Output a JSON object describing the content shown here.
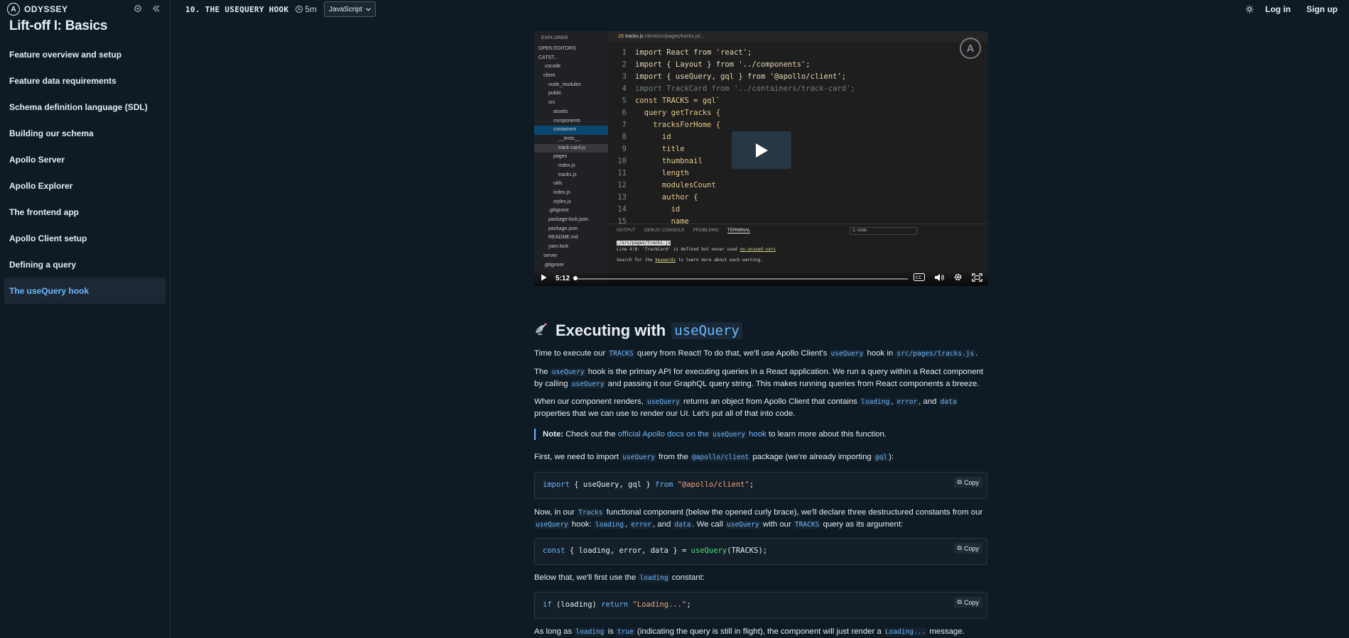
{
  "brand": "ODYSSEY",
  "course_title": "Lift-off I: Basics",
  "nav": [
    "Feature overview and setup",
    "Feature data requirements",
    "Schema definition language (SDL)",
    "Building our schema",
    "Apollo Server",
    "Apollo Explorer",
    "The frontend app",
    "Apollo Client setup",
    "Defining a query",
    "The useQuery hook"
  ],
  "topbar": {
    "lesson_title": "10. THE USEQUERY HOOK",
    "duration": "5m",
    "language": "JavaScript",
    "login": "Log in",
    "signup": "Sign up"
  },
  "video": {
    "tab_file": "tracks.js",
    "tab_path": "client/src/pages/tracks.js/...",
    "explorer_title": "EXPLORER",
    "explorer_rows": [
      "OPEN EDITORS",
      "CATST...",
      ".vscode",
      "client",
      "node_modules",
      "public",
      "src",
      "assets",
      "components",
      "containers",
      "__tests__",
      "track-card.js",
      "pages",
      "index.js",
      "tracks.js",
      "utils",
      "index.js",
      "styles.js",
      ".gitignore",
      "package-lock.json",
      "package.json",
      "README.md",
      "yarn.lock",
      "server",
      ".gitignore"
    ],
    "code_lines": [
      "import React from 'react';",
      "import { Layout } from '../components';",
      "import { useQuery, gql } from '@apollo/client';",
      "import TrackCard from '../containers/track-card';",
      "const TRACKS = gql`",
      "  query getTracks {",
      "    tracksForHome {",
      "      id",
      "      title",
      "      thumbnail",
      "      length",
      "      modulesCount",
      "      author {",
      "        id",
      "        name"
    ],
    "panel_tabs": [
      "OUTPUT",
      "DEBUG CONSOLE",
      "PROBLEMS",
      "TERMINAL"
    ],
    "terminal_select": "1: node",
    "terminal_path": "./src/pages/tracks.js",
    "terminal_line1": "Line 4:8:  'TrackCard' is defined but never used",
    "terminal_rule": "no-unused-vars",
    "terminal_line2_a": "Search for the ",
    "terminal_line2_kw": "keywords",
    "terminal_line2_b": " to learn more about each warning.",
    "time": "5:12",
    "progress": 0.0
  },
  "article": {
    "heading_text": "Executing with",
    "heading_code": "useQuery",
    "p1": [
      "Time to execute our ",
      "TRACKS",
      " query from React! To do that, we'll use Apollo Client's ",
      "useQuery",
      " hook in ",
      "src/pages/tracks.js",
      "."
    ],
    "p2": [
      "The ",
      "useQuery",
      " hook is the primary API for executing queries in a React application. We run a query within a React component by calling ",
      "useQuery",
      " and passing it our GraphQL query string. This makes running queries from React components a breeze."
    ],
    "p3": [
      "When our component renders, ",
      "useQuery",
      " returns an object from Apollo Client that contains ",
      "loading",
      ", ",
      "error",
      ", and ",
      "data",
      " properties that we can use to render our UI. Let's put all of that into code."
    ],
    "note": [
      "Note:",
      " Check out the ",
      "official Apollo docs on the ",
      "useQuery",
      " hook",
      " to learn more about this function."
    ],
    "p4": [
      "First, we need to import ",
      "useQuery",
      " from the ",
      "@apollo/client",
      " package (we're already importing ",
      "gql",
      "):"
    ],
    "code1": [
      "import",
      " { useQuery, gql } ",
      "from",
      " ",
      "\"@apollo/client\"",
      ";"
    ],
    "p5": [
      "Now, in our ",
      "Tracks",
      " functional component (below the opened curly brace), we'll declare three destructured constants from our ",
      "useQuery",
      " hook: ",
      "loading",
      ", ",
      "error",
      ", and ",
      "data",
      ". We call ",
      "useQuery",
      " with our ",
      "TRACKS",
      " query as its argument:"
    ],
    "code2": [
      "const",
      " { loading, error, data } = ",
      "useQuery",
      "(TRACKS);"
    ],
    "p6": [
      "Below that, we'll first use the ",
      "loading",
      " constant:"
    ],
    "code3": [
      "if",
      " (loading) ",
      "return",
      " ",
      "\"Loading...\"",
      ";"
    ],
    "p7": [
      "As long as ",
      "loading",
      " is ",
      "true",
      " (indicating the query is still in flight), the component will just render a ",
      "Loading...",
      " message."
    ],
    "copy_label": "Copy"
  },
  "colors": {
    "accent": "#6ab8ff",
    "bg": "#0f1b24"
  }
}
